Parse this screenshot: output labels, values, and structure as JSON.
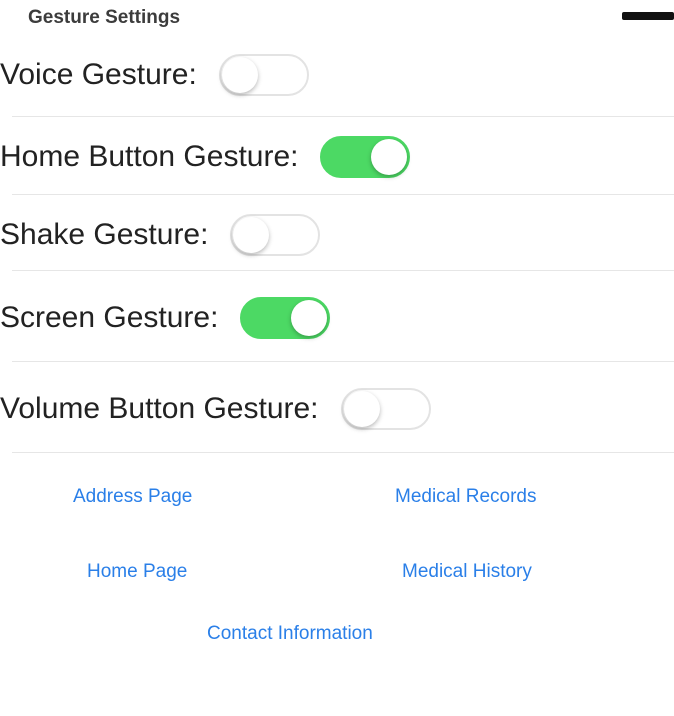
{
  "header": {
    "title": "Gesture Settings"
  },
  "settings": [
    {
      "label": "Voice Gesture:",
      "enabled": false
    },
    {
      "label": "Home Button Gesture:",
      "enabled": true
    },
    {
      "label": "Shake Gesture:",
      "enabled": false
    },
    {
      "label": "Screen Gesture:",
      "enabled": true
    },
    {
      "label": "Volume Button Gesture:",
      "enabled": false
    }
  ],
  "links": {
    "address": "Address Page",
    "medical_records": "Medical Records",
    "home": "Home Page",
    "medical_history": "Medical History",
    "contact": "Contact Information"
  },
  "colors": {
    "toggle_on": "#4cd964",
    "link": "#2a7fe8"
  }
}
